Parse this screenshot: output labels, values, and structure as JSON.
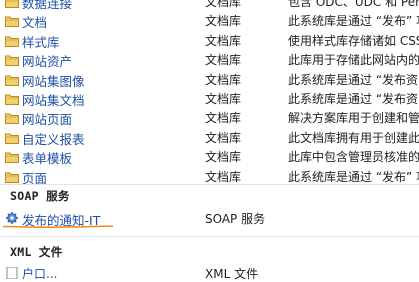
{
  "libraries": [
    {
      "name": "数据连接",
      "type": "文档库",
      "desc": "包含 ODC、UDC 和 Perfor"
    },
    {
      "name": "文档",
      "type": "文档库",
      "desc": "此系统库是通过 “发布” 功"
    },
    {
      "name": "样式库",
      "type": "文档库",
      "desc": "使用样式库存储诸如 CSS"
    },
    {
      "name": "网站资产",
      "type": "文档库",
      "desc": "此库用于存储此网站内的"
    },
    {
      "name": "网站集图像",
      "type": "文档库",
      "desc": "此系统库是通过 “发布资"
    },
    {
      "name": "网站集文档",
      "type": "文档库",
      "desc": "此系统库是通过 “发布资"
    },
    {
      "name": "网站页面",
      "type": "文档库",
      "desc": "解决方案库用于创建和管"
    },
    {
      "name": "自定义报表",
      "type": "文档库",
      "desc": "此文档库拥有用于创建此"
    },
    {
      "name": "表单模板",
      "type": "文档库",
      "desc": "此库中包含管理员核准的"
    },
    {
      "name": "页面",
      "type": "文档库",
      "desc": "此系统库是通过 “发布” 功"
    }
  ],
  "soap_section": {
    "title": "SOAP 服务"
  },
  "soap_item": {
    "name": "发布的通知-IT",
    "type": "SOAP 服务"
  },
  "xml_section": {
    "title": "XML 文件"
  },
  "xml_item": {
    "name": "户口...",
    "type": "XML 文件"
  },
  "colors": {
    "link": "#1f4fa8",
    "underline": "#f08a1c",
    "folder": "#e8b84a"
  }
}
